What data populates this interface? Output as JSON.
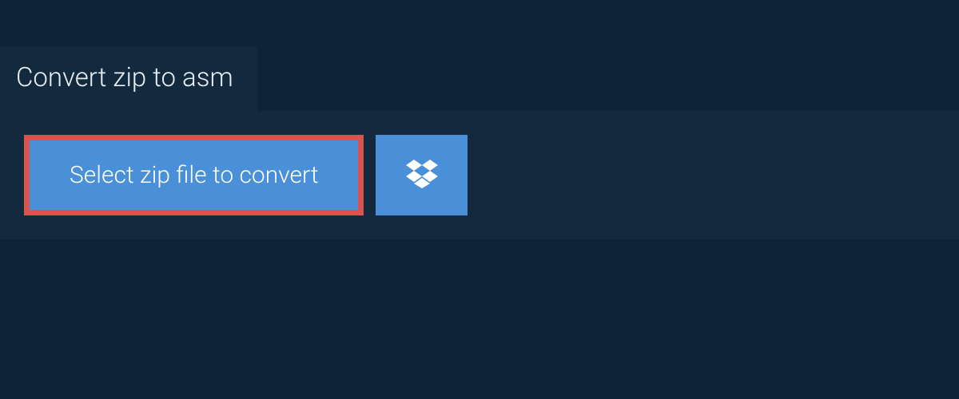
{
  "header": {
    "title": "Convert zip to asm"
  },
  "actions": {
    "select_file_label": "Select zip file to convert"
  }
}
